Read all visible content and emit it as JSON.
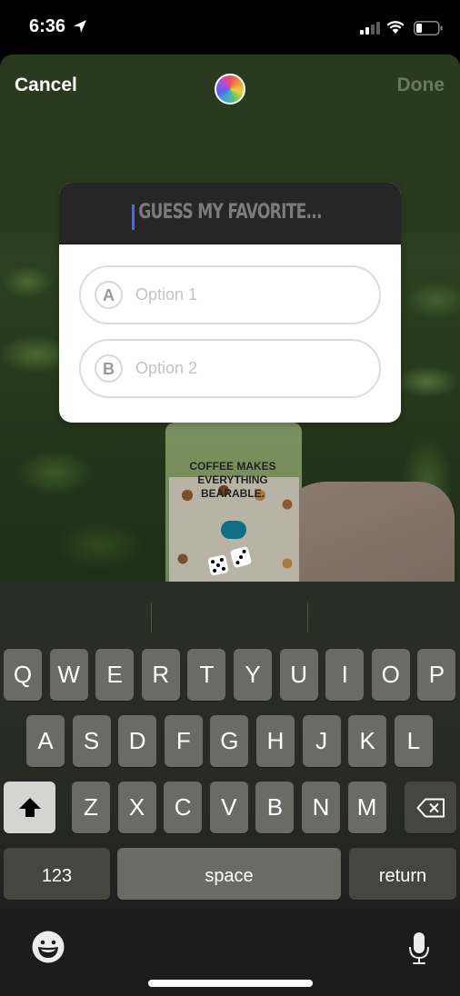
{
  "status_bar": {
    "time": "6:36",
    "icons": [
      "location-arrow-icon",
      "cellular-signal-icon",
      "wifi-icon",
      "battery-icon"
    ]
  },
  "header": {
    "cancel_label": "Cancel",
    "done_label": "Done",
    "color_picker_icon": "color-wheel-icon"
  },
  "quiz": {
    "question_placeholder": "GUESS MY FAVORITE...",
    "options": [
      {
        "letter": "A",
        "placeholder": "Option 1"
      },
      {
        "letter": "B",
        "placeholder": "Option 2"
      }
    ],
    "colors": {
      "cursor": "#3f6cf5",
      "header_bg": "#262626"
    }
  },
  "photo": {
    "sleeve_text": "COFFEE MAKES EVERYTHING BEARABLE.",
    "sticker": "dice-icon"
  },
  "keyboard": {
    "row1": [
      "Q",
      "W",
      "E",
      "R",
      "T",
      "Y",
      "U",
      "I",
      "O",
      "P"
    ],
    "row2": [
      "A",
      "S",
      "D",
      "F",
      "G",
      "H",
      "J",
      "K",
      "L"
    ],
    "row3": [
      "Z",
      "X",
      "C",
      "V",
      "B",
      "N",
      "M"
    ],
    "shift_icon": "shift-icon",
    "delete_icon": "delete-icon",
    "numbers_label": "123",
    "space_label": "space",
    "return_label": "return",
    "emoji_icon": "emoji-icon",
    "mic_icon": "microphone-icon"
  }
}
